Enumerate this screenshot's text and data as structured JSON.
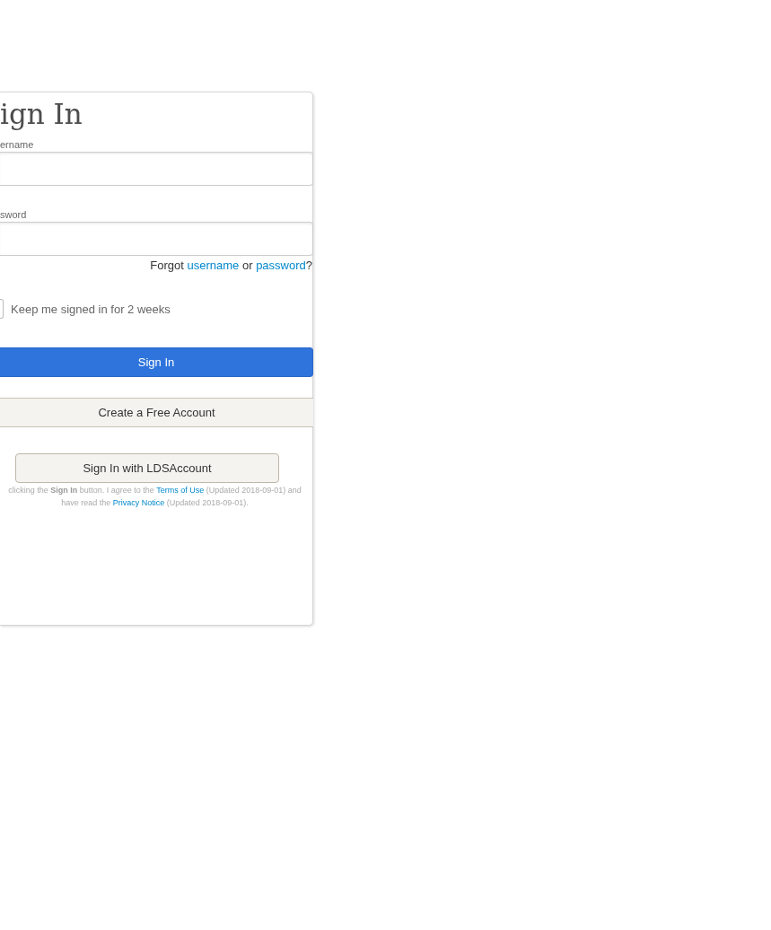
{
  "title": "ign In",
  "username": {
    "label": "ername"
  },
  "password": {
    "label": "sword"
  },
  "forgot": [
    {
      "kind": "text",
      "text": "Forgot"
    },
    {
      "kind": "link",
      "text": "username"
    },
    {
      "kind": "text",
      "text": "or"
    },
    {
      "kind": "link",
      "text": "password"
    },
    {
      "kind": "text",
      "text": "?"
    }
  ],
  "remember": {
    "label": "Keep me signed in for 2 weeks",
    "checked": false
  },
  "sign_in_button": "Sign In",
  "create_account_button": "Create a Free Account",
  "lds_button": "Sign In with LDSAccount",
  "legal": [
    {
      "kind": "text",
      "text": "clicking the **Sign In** button. I agree to the"
    },
    {
      "kind": "link",
      "text": "Terms of Use"
    },
    {
      "kind": "text",
      "text": "(Updated 2018-09-01) and have read the"
    },
    {
      "kind": "link",
      "text": "Privacy Notice"
    },
    {
      "kind": "text",
      "text": "(Updated 2018-09-01)."
    }
  ]
}
